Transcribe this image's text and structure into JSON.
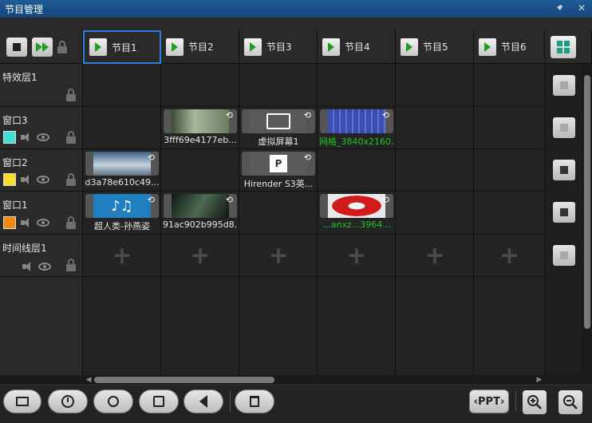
{
  "window": {
    "title": "节目管理",
    "pin_icon": "pin-icon",
    "close_icon": "close-icon",
    "close_glyph": "✕"
  },
  "programs": [
    {
      "label": "节目1",
      "active": true
    },
    {
      "label": "节目2"
    },
    {
      "label": "节目3"
    },
    {
      "label": "节目4"
    },
    {
      "label": "节目5"
    },
    {
      "label": "节目6"
    }
  ],
  "layers": [
    {
      "name": "特效层1",
      "color": null,
      "has_audio": false,
      "has_eye": false
    },
    {
      "name": "窗口3",
      "color": "#3fe3d3",
      "has_audio": true,
      "has_eye": true
    },
    {
      "name": "窗口2",
      "color": "#f3e02a",
      "has_audio": true,
      "has_eye": true
    },
    {
      "name": "窗口1",
      "color": "#f08a0e",
      "has_audio": true,
      "has_eye": true
    },
    {
      "name": "时间线层1",
      "color": null,
      "has_audio": true,
      "has_eye": true
    }
  ],
  "clips": {
    "window3": [
      {
        "label": "3fff69e4177eb...",
        "type": "video"
      },
      {
        "label": "虚拟屏幕1",
        "type": "virtual-screen"
      },
      {
        "label": "网格_3840x2160...",
        "type": "grid",
        "label_color": "green"
      }
    ],
    "window2": [
      {
        "label": "d3a78e610c49...",
        "type": "image"
      },
      {
        "label": "Hirender S3英...",
        "type": "ppt"
      }
    ],
    "window1": [
      {
        "label": "超人类-孙燕姿",
        "type": "audio"
      },
      {
        "label": "91ac902b995d8...",
        "type": "video"
      },
      {
        "label": "...anxz...3964...",
        "type": "image",
        "label_color": "green"
      }
    ]
  },
  "timeline_add_glyph": "+",
  "toolbar": {
    "buttons": [
      "frame-icon",
      "clock-icon",
      "target-icon",
      "add-media-icon",
      "tag-icon"
    ],
    "delete": "trash-icon",
    "ppt_label": "‹PPT›",
    "zoom_in": "zoom-in-icon",
    "zoom_out": "zoom-out-icon"
  },
  "colors": {
    "titlebar": "#1f5c95",
    "active_border": "#2f7fd6",
    "play_green": "#1f9d1f",
    "add_program": "#1aa089"
  }
}
